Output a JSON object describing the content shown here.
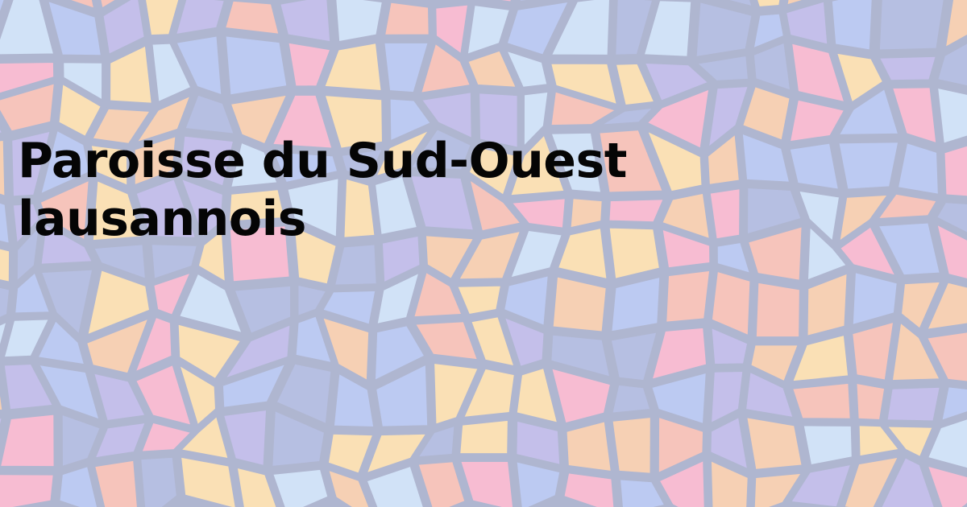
{
  "page": {
    "title_lines": [
      "Paroisse du Sud-Ouest",
      "lausannois"
    ]
  },
  "background": {
    "pattern": "stained-glass-mosaic",
    "colors": [
      "#aebfef",
      "#b7b1e6",
      "#f4b7ac",
      "#f5c6a4",
      "#f6aec9",
      "#f9d9a5",
      "#c7dcf6",
      "#a7b1dc"
    ],
    "lead_color": "#9ea6c6"
  }
}
